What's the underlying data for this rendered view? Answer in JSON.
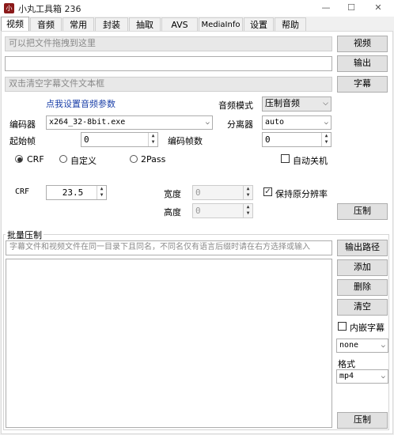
{
  "window": {
    "title": "小丸工具箱 236",
    "icon_text": "小",
    "minimize": "—",
    "maximize": "☐",
    "close": "✕"
  },
  "tabs": [
    "视频",
    "音频",
    "常用",
    "封装",
    "抽取",
    "AVS",
    "MediaInfo",
    "设置",
    "帮助"
  ],
  "video_tab": {
    "video_input_placeholder": "可以把文件拖拽到这里",
    "video_button": "视频",
    "output_button": "输出",
    "subtitle_input_placeholder": "双击清空字幕文件文本框",
    "subtitle_button": "字幕",
    "audio_settings_link": "点我设置音频参数",
    "audio_mode_label": "音频模式",
    "audio_mode_value": "压制音频",
    "encoder_label": "编码器",
    "encoder_value": "x264_32-8bit.exe",
    "demuxer_label": "分离器",
    "demuxer_value": "auto",
    "start_frame_label": "起始帧",
    "start_frame_value": "0",
    "encode_frames_label": "编码帧数",
    "encode_frames_value": "0",
    "mode_crf": "CRF",
    "mode_custom": "自定义",
    "mode_2pass": "2Pass",
    "auto_shutdown": "自动关机",
    "crf_label": "CRF",
    "crf_value": "23.5",
    "width_label": "宽度",
    "width_value": "0",
    "height_label": "高度",
    "height_value": "0",
    "keep_resolution": "保持原分辨率",
    "encode_button": "压制"
  },
  "batch": {
    "group_label": "批量压制",
    "hint": "字幕文件和视频文件在同一目录下且同名，不同名仅有语言后缀时请在右方选择或输入",
    "output_path_button": "输出路径",
    "add_button": "添加",
    "delete_button": "删除",
    "clear_button": "清空",
    "embed_subtitle": "内嵌字幕",
    "subtitle_lang_value": "none",
    "format_label": "格式",
    "format_value": "mp4",
    "encode_button": "压制"
  }
}
